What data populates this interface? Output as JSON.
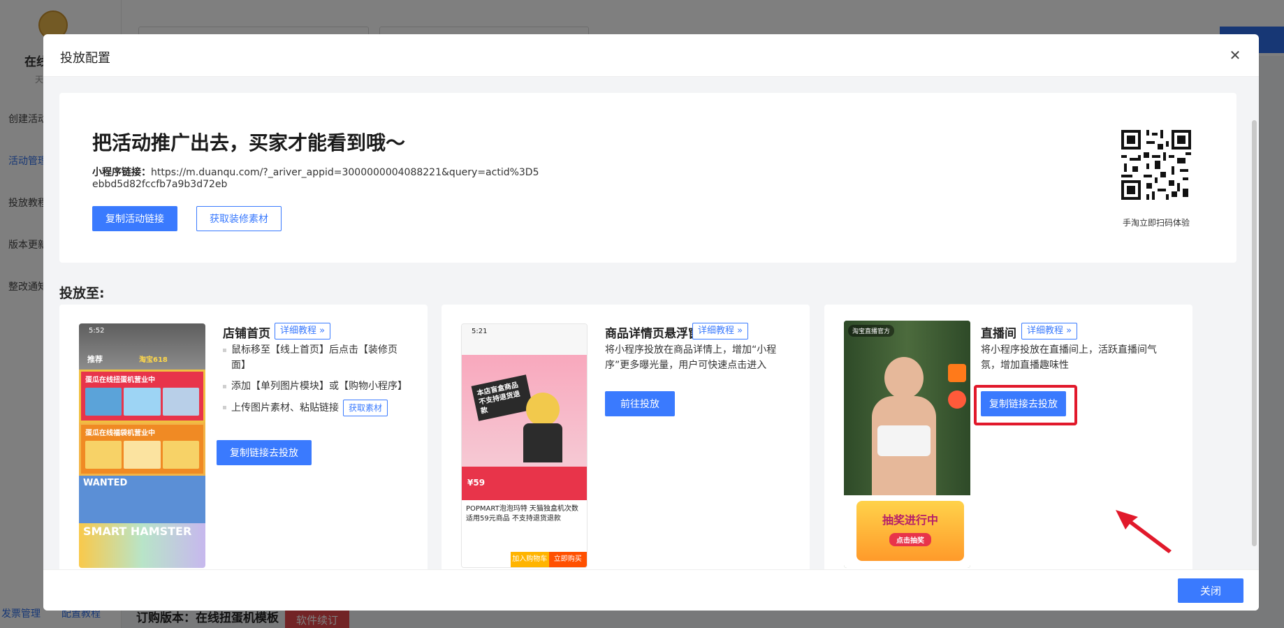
{
  "background": {
    "shop_name": "在线",
    "shop_sub": "天",
    "nav": [
      "创建活动",
      "活动管理",
      "投放教程",
      "版本更新",
      "整改通知"
    ],
    "bottom_links": [
      "发票管理",
      "配置教程"
    ],
    "footer_title": "订购版本：在线扭蛋机模板",
    "footer_button": "软件续订"
  },
  "modal": {
    "title": "投放配置",
    "close_icon": "close-icon",
    "footer_close": "关闭"
  },
  "promo": {
    "heading": "把活动推广出去，买家才能看到哦～",
    "link_label": "小程序链接：",
    "link_url": "https://m.duanqu.com/?_ariver_appid=3000000004088221&query=actid%3D5ebbd5d82fccfb7a9b3d72eb",
    "copy_button": "复制活动链接",
    "material_button": "获取装修素材",
    "qr_caption": "手淘立即扫码体验"
  },
  "section_label": "投放至:",
  "cards": [
    {
      "title": "店铺首页",
      "tutorial": "详细教程",
      "steps": [
        "鼠标移至【线上首页】后点击【装修页面】",
        "添加【单列图片模块】或【购物小程序】",
        "上传图片素材、粘贴链接"
      ],
      "step_button": "获取素材",
      "button": "复制链接去投放",
      "preview_texts": [
        "5:52",
        "推荐",
        "淘宝618",
        "蛋瓜在线扭蛋机营业中",
        "蛋瓜在线福袋机营业中",
        "WANTED",
        "SMART HAMSTER"
      ]
    },
    {
      "title": "商品详情页悬浮窗",
      "tutorial": "详细教程",
      "desc": "将小程序投放在商品详情上，增加“小程序”更多曝光量，用户可快速点击进入",
      "button": "前往投放",
      "preview_texts": [
        "5:21",
        "本店盲盒商品不支持退货退款",
        "¥59",
        "POPMART泡泡玛特 天猫独盒机次数 适用59元商品 不支持退货退款",
        "加入购物车",
        "立即购买"
      ]
    },
    {
      "title": "直播间",
      "tutorial": "详细教程",
      "desc": "将小程序投放在直播间上，活跃直播间气氛，增加直播趣味性",
      "button": "复制链接去投放",
      "preview_texts": [
        "淘宝直播官方",
        "抽奖进行中",
        "点击抽奖"
      ]
    }
  ],
  "colors": {
    "primary": "#3a7afe",
    "highlight": "#e1192b"
  }
}
